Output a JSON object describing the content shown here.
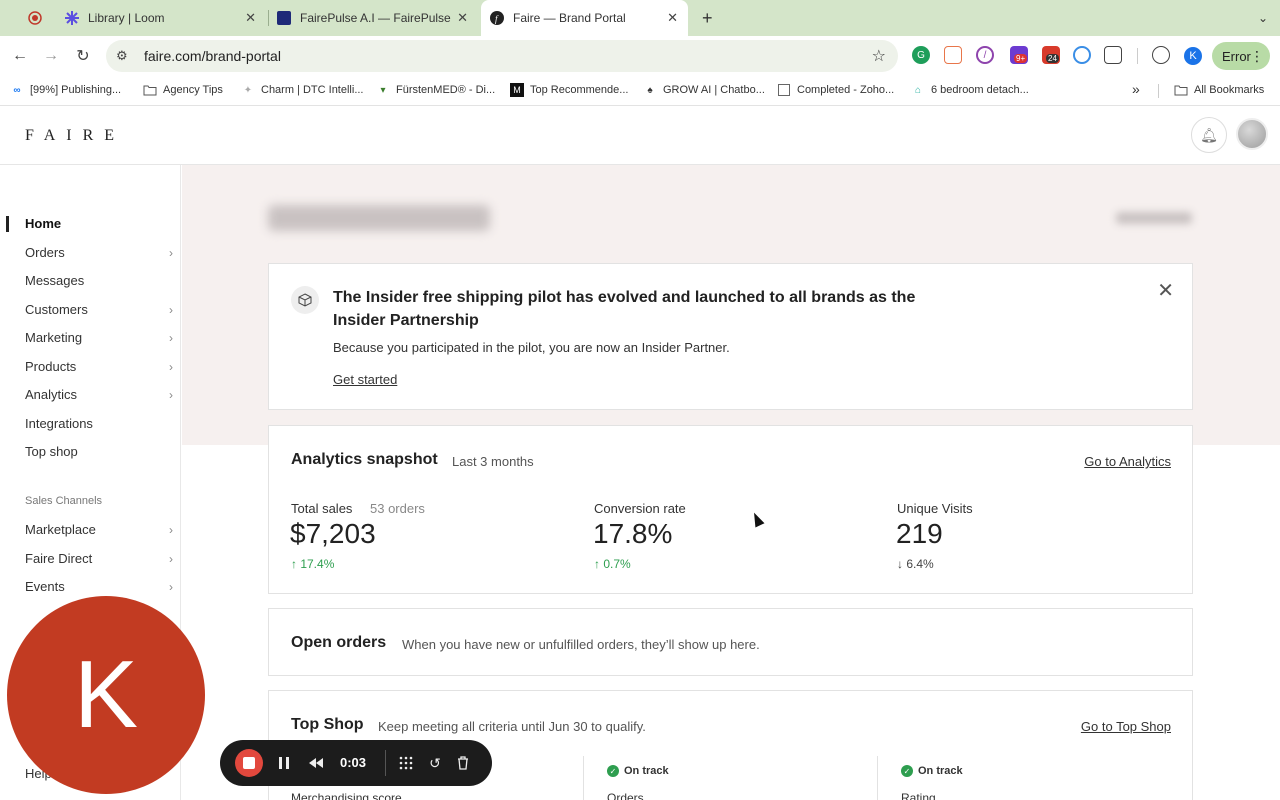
{
  "browser": {
    "tabs": [
      {
        "title": "Library | Loom",
        "icon": "loom-icon"
      },
      {
        "title": "FairePulse A.I — FairePulse",
        "icon": "fairepulse-icon"
      },
      {
        "title": "Faire — Brand Portal",
        "icon": "faire-icon",
        "active": true
      }
    ],
    "url": "faire.com/brand-portal",
    "profile_initial": "K",
    "error_label": "Error",
    "ext_badges": [
      "9+",
      "24"
    ],
    "bookmarks": [
      "[99%] Publishing...",
      "Agency Tips",
      "Charm | DTC Intelli...",
      "FürstenMED® - Di...",
      "Top Recommende...",
      "GROW AI | Chatbo...",
      "Completed - Zoho...",
      "6 bedroom detach..."
    ],
    "all_bookmarks": "All Bookmarks"
  },
  "faire": {
    "logo": "FAIRE",
    "sidebar": {
      "items": [
        {
          "label": "Home",
          "active": true,
          "chevron": false
        },
        {
          "label": "Orders",
          "chevron": true
        },
        {
          "label": "Messages",
          "chevron": false
        },
        {
          "label": "Customers",
          "chevron": true
        },
        {
          "label": "Marketing",
          "chevron": true
        },
        {
          "label": "Products",
          "chevron": true
        },
        {
          "label": "Analytics",
          "chevron": true
        },
        {
          "label": "Integrations",
          "chevron": false
        },
        {
          "label": "Top shop",
          "chevron": false
        }
      ],
      "section_label": "Sales Channels",
      "channels": [
        {
          "label": "Marketplace",
          "chevron": true
        },
        {
          "label": "Faire Direct",
          "chevron": true
        },
        {
          "label": "Events",
          "chevron": true
        }
      ],
      "help": "Help"
    },
    "banner": {
      "title": "The Insider free shipping pilot has evolved and launched to all brands as the Insider Partnership",
      "text": "Because you participated in the pilot, you are now an Insider Partner.",
      "link": "Get started"
    },
    "analytics": {
      "title": "Analytics snapshot",
      "period": "Last 3 months",
      "link": "Go to Analytics",
      "metrics": [
        {
          "label": "Total sales",
          "sub": "53 orders",
          "value": "$7,203",
          "delta": "↑ 17.4%",
          "direction": "up"
        },
        {
          "label": "Conversion rate",
          "sub": "",
          "value": "17.8%",
          "delta": "↑ 0.7%",
          "direction": "up"
        },
        {
          "label": "Unique Visits",
          "sub": "",
          "value": "219",
          "delta": "↓ 6.4%",
          "direction": "down"
        }
      ]
    },
    "open_orders": {
      "title": "Open orders",
      "text": "When you have new or unfulfilled orders, they’ll show up here."
    },
    "top_shop": {
      "title": "Top Shop",
      "text": "Keep meeting all criteria until Jun 30 to qualify.",
      "link": "Go to Top Shop",
      "status_label": "On track",
      "criteria": [
        "Merchandising score",
        "Orders",
        "Rating"
      ]
    }
  },
  "loom": {
    "camera_initial": "K",
    "timer": "0:03"
  },
  "colors": {
    "tabbar_bg": "#d4e5c9",
    "positive": "#2e9e4f",
    "loom_camera": "#c23b22",
    "loom_stop": "#e2483d"
  }
}
